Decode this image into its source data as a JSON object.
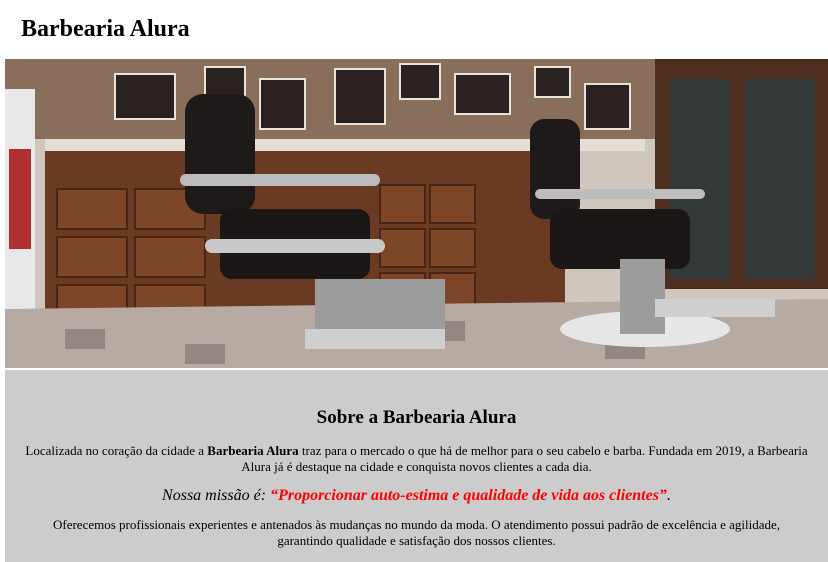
{
  "header": {
    "title": "Barbearia Alura"
  },
  "hero": {
    "image_name": "barbershop-interior-photo",
    "colors": {
      "wall": "#d9d4cc",
      "wood": "#6b3a22",
      "dark": "#1a1716",
      "floor": "#b7aaa3"
    }
  },
  "about": {
    "title": "Sobre a Barbearia Alura",
    "p1_before": "Localizada no coração da cidade a ",
    "p1_bold": "Barbearia Alura",
    "p1_after": " traz para o mercado o que há de melhor para o seu cabelo e barba. Fundada em 2019, a Barbearia Alura já é destaque na cidade e conquista novos clientes a cada dia.",
    "mission_label": "Nossa missão é: ",
    "mission_quote": "“Proporcionar auto-estima e qualidade de vida aos clientes”",
    "mission_end": ".",
    "p3": "Oferecemos profissionais experientes e antenados às mudanças no mundo da moda. O atendimento possui padrão de excelência e agilidade, garantindo qualidade e satisfação dos nossos clientes.",
    "colors": {
      "background": "#cccccc",
      "quote": "#ff0000"
    }
  }
}
